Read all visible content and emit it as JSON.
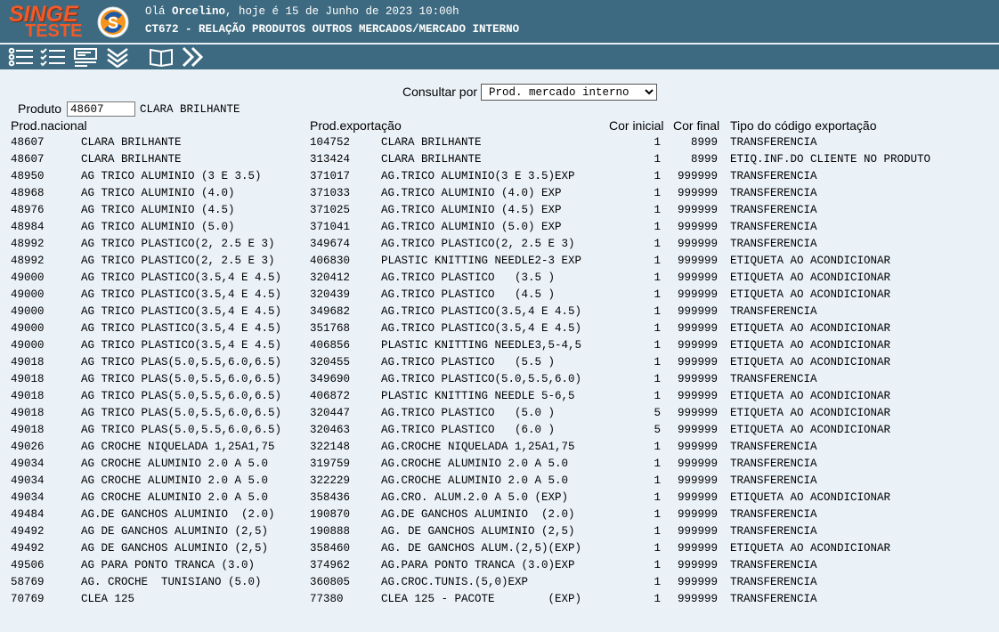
{
  "header": {
    "logo_line1": "SINGE",
    "logo_line2": "TESTE",
    "greeting_prefix": "Olá ",
    "user": "Orcelino",
    "greeting_suffix": ", hoje é 15 de Junho de 2023 10:00h",
    "title": "CT672 - RELAÇÃO PRODUTOS OUTROS MERCADOS/MERCADO INTERNO"
  },
  "toolbar": {
    "icons": [
      "list-icon",
      "checklist-icon",
      "form-icon",
      "double-chevron-down-icon",
      "book-icon",
      "double-chevron-right-icon"
    ]
  },
  "form": {
    "consultar_label": "Consultar por",
    "consultar_value": "Prod. mercado interno",
    "produto_label": "Produto",
    "produto_value": "48607",
    "produto_desc": "CLARA BRILHANTE"
  },
  "table": {
    "headers": {
      "prod_nacional": "Prod.nacional",
      "prod_exportacao": "Prod.exportação",
      "cor_inicial": "Cor inicial",
      "cor_final": "Cor final",
      "tipo": "Tipo do código exportação"
    },
    "rows": [
      [
        "48607",
        "CLARA BRILHANTE",
        "104752",
        "CLARA BRILHANTE",
        "1",
        "8999",
        "TRANSFERENCIA"
      ],
      [
        "48607",
        "CLARA BRILHANTE",
        "313424",
        "CLARA BRILHANTE",
        "1",
        "8999",
        "ETIQ.INF.DO CLIENTE NO PRODUTO"
      ],
      [
        "48950",
        "AG TRICO ALUMINIO (3 E 3.5)",
        "371017",
        "AG.TRICO ALUMINIO(3 E 3.5)EXP",
        "1",
        "999999",
        "TRANSFERENCIA"
      ],
      [
        "48968",
        "AG TRICO ALUMINIO (4.0)",
        "371033",
        "AG.TRICO ALUMINIO (4.0) EXP",
        "1",
        "999999",
        "TRANSFERENCIA"
      ],
      [
        "48976",
        "AG TRICO ALUMINIO (4.5)",
        "371025",
        "AG.TRICO ALUMINIO (4.5) EXP",
        "1",
        "999999",
        "TRANSFERENCIA"
      ],
      [
        "48984",
        "AG TRICO ALUMINIO (5.0)",
        "371041",
        "AG.TRICO ALUMINIO (5.0) EXP",
        "1",
        "999999",
        "TRANSFERENCIA"
      ],
      [
        "48992",
        "AG TRICO PLASTICO(2, 2.5 E 3)",
        "349674",
        "AG.TRICO PLASTICO(2, 2.5 E 3)",
        "1",
        "999999",
        "TRANSFERENCIA"
      ],
      [
        "48992",
        "AG TRICO PLASTICO(2, 2.5 E 3)",
        "406830",
        "PLASTIC KNITTING NEEDLE2-3 EXP",
        "1",
        "999999",
        "ETIQUETA AO ACONDICIONAR"
      ],
      [
        "49000",
        "AG TRICO PLASTICO(3.5,4 E 4.5)",
        "320412",
        "AG.TRICO PLASTICO   (3.5 )",
        "1",
        "999999",
        "ETIQUETA AO ACONDICIONAR"
      ],
      [
        "49000",
        "AG TRICO PLASTICO(3.5,4 E 4.5)",
        "320439",
        "AG.TRICO PLASTICO   (4.5 )",
        "1",
        "999999",
        "ETIQUETA AO ACONDICIONAR"
      ],
      [
        "49000",
        "AG TRICO PLASTICO(3.5,4 E 4.5)",
        "349682",
        "AG.TRICO PLASTICO(3.5,4 E 4.5)",
        "1",
        "999999",
        "TRANSFERENCIA"
      ],
      [
        "49000",
        "AG TRICO PLASTICO(3.5,4 E 4.5)",
        "351768",
        "AG.TRICO PLASTICO(3.5,4 E 4.5)",
        "1",
        "999999",
        "ETIQUETA AO ACONDICIONAR"
      ],
      [
        "49000",
        "AG TRICO PLASTICO(3.5,4 E 4.5)",
        "406856",
        "PLASTIC KNITTING NEEDLE3,5-4,5",
        "1",
        "999999",
        "ETIQUETA AO ACONDICIONAR"
      ],
      [
        "49018",
        "AG TRICO PLAS(5.0,5.5,6.0,6.5)",
        "320455",
        "AG.TRICO PLASTICO   (5.5 )",
        "1",
        "999999",
        "ETIQUETA AO ACONDICIONAR"
      ],
      [
        "49018",
        "AG TRICO PLAS(5.0,5.5,6.0,6.5)",
        "349690",
        "AG.TRICO PLASTICO(5.0,5.5,6.0)",
        "1",
        "999999",
        "TRANSFERENCIA"
      ],
      [
        "49018",
        "AG TRICO PLAS(5.0,5.5,6.0,6.5)",
        "406872",
        "PLASTIC KNITTING NEEDLE 5-6,5",
        "1",
        "999999",
        "ETIQUETA AO ACONDICIONAR"
      ],
      [
        "49018",
        "AG TRICO PLAS(5.0,5.5,6.0,6.5)",
        "320447",
        "AG.TRICO PLASTICO   (5.0 )",
        "5",
        "999999",
        "ETIQUETA AO ACONDICIONAR"
      ],
      [
        "49018",
        "AG TRICO PLAS(5.0,5.5,6.0,6.5)",
        "320463",
        "AG.TRICO PLASTICO   (6.0 )",
        "5",
        "999999",
        "ETIQUETA AO ACONDICIONAR"
      ],
      [
        "49026",
        "AG CROCHE NIQUELADA 1,25A1,75",
        "322148",
        "AG.CROCHE NIQUELADA 1,25A1,75",
        "1",
        "999999",
        "TRANSFERENCIA"
      ],
      [
        "49034",
        "AG CROCHE ALUMINIO 2.0 A 5.0",
        "319759",
        "AG.CROCHE ALUMINIO 2.0 A 5.0",
        "1",
        "999999",
        "TRANSFERENCIA"
      ],
      [
        "49034",
        "AG CROCHE ALUMINIO 2.0 A 5.0",
        "322229",
        "AG.CROCHE ALUMINIO 2.0 A 5.0",
        "1",
        "999999",
        "TRANSFERENCIA"
      ],
      [
        "49034",
        "AG CROCHE ALUMINIO 2.0 A 5.0",
        "358436",
        "AG.CRO. ALUM.2.0 A 5.0 (EXP)",
        "1",
        "999999",
        "ETIQUETA AO ACONDICIONAR"
      ],
      [
        "49484",
        "AG.DE GANCHOS ALUMINIO  (2.0)",
        "190870",
        "AG.DE GANCHOS ALUMINIO  (2.0)",
        "1",
        "999999",
        "TRANSFERENCIA"
      ],
      [
        "49492",
        "AG DE GANCHOS ALUMINIO (2,5)",
        "190888",
        "AG. DE GANCHOS ALUMINIO (2,5)",
        "1",
        "999999",
        "TRANSFERENCIA"
      ],
      [
        "49492",
        "AG DE GANCHOS ALUMINIO (2,5)",
        "358460",
        "AG. DE GANCHOS ALUM.(2,5)(EXP)",
        "1",
        "999999",
        "ETIQUETA AO ACONDICIONAR"
      ],
      [
        "49506",
        "AG PARA PONTO TRANCA (3.0)",
        "374962",
        "AG.PARA PONTO TRANCA (3.0)EXP",
        "1",
        "999999",
        "TRANSFERENCIA"
      ],
      [
        "58769",
        "AG. CROCHE  TUNISIANO (5.0)",
        "360805",
        "AG.CROC.TUNIS.(5,0)EXP",
        "1",
        "999999",
        "TRANSFERENCIA"
      ],
      [
        "70769",
        "CLEA 125",
        "77380",
        "CLEA 125 - PACOTE        (EXP)",
        "1",
        "999999",
        "TRANSFERENCIA"
      ]
    ]
  }
}
